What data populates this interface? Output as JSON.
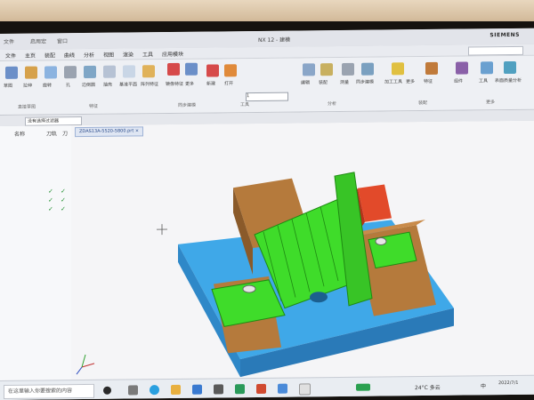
{
  "window": {
    "app_title": "NX 12 - 建模",
    "brand": "SIEMENS",
    "quick_tools": [
      "文件",
      "启用宏",
      "窗口"
    ]
  },
  "menu": {
    "items": [
      "文件",
      "主页",
      "装配",
      "曲线",
      "分析",
      "视图",
      "渲染",
      "工具",
      "应用模块"
    ]
  },
  "ribbon": {
    "button_labels": [
      "草图",
      "拉伸",
      "旋转",
      "孔",
      "边倒圆",
      "抽壳",
      "基准平面",
      "阵列特征",
      "镜像特征",
      "更多",
      "新建",
      "打开",
      "编辑",
      "装配",
      "测量",
      "同步建模",
      "加工工具",
      "更多",
      "特征",
      "组件",
      "工具",
      "表面质量分析"
    ],
    "group_labels": [
      "直接草图",
      "特征",
      "同步建模",
      "工具",
      "分析",
      "装配",
      "更多"
    ],
    "part_combo": "1"
  },
  "filter": {
    "value": "没有选择过滤器"
  },
  "navigator": {
    "headers": [
      "名称",
      "刀轨",
      "刀"
    ],
    "rows": [
      {
        "ok": "✓",
        "ok2": "✓"
      },
      {
        "ok": "✓",
        "ok2": "✓"
      },
      {
        "ok": "✓",
        "ok2": "✓"
      }
    ]
  },
  "document": {
    "tab_label": "ZDAS13A-5520-5800.prt ×"
  },
  "taskbar": {
    "search_placeholder": "在这里输入你要搜索的内容",
    "weather": "24°C 多云",
    "time": "2022/7/1",
    "ime": "中"
  },
  "colors": {
    "base_plate": "#3fa8e8",
    "blocks": "#b57a3c",
    "part": "#3fdc2a",
    "clamp_red": "#e24a2a"
  }
}
